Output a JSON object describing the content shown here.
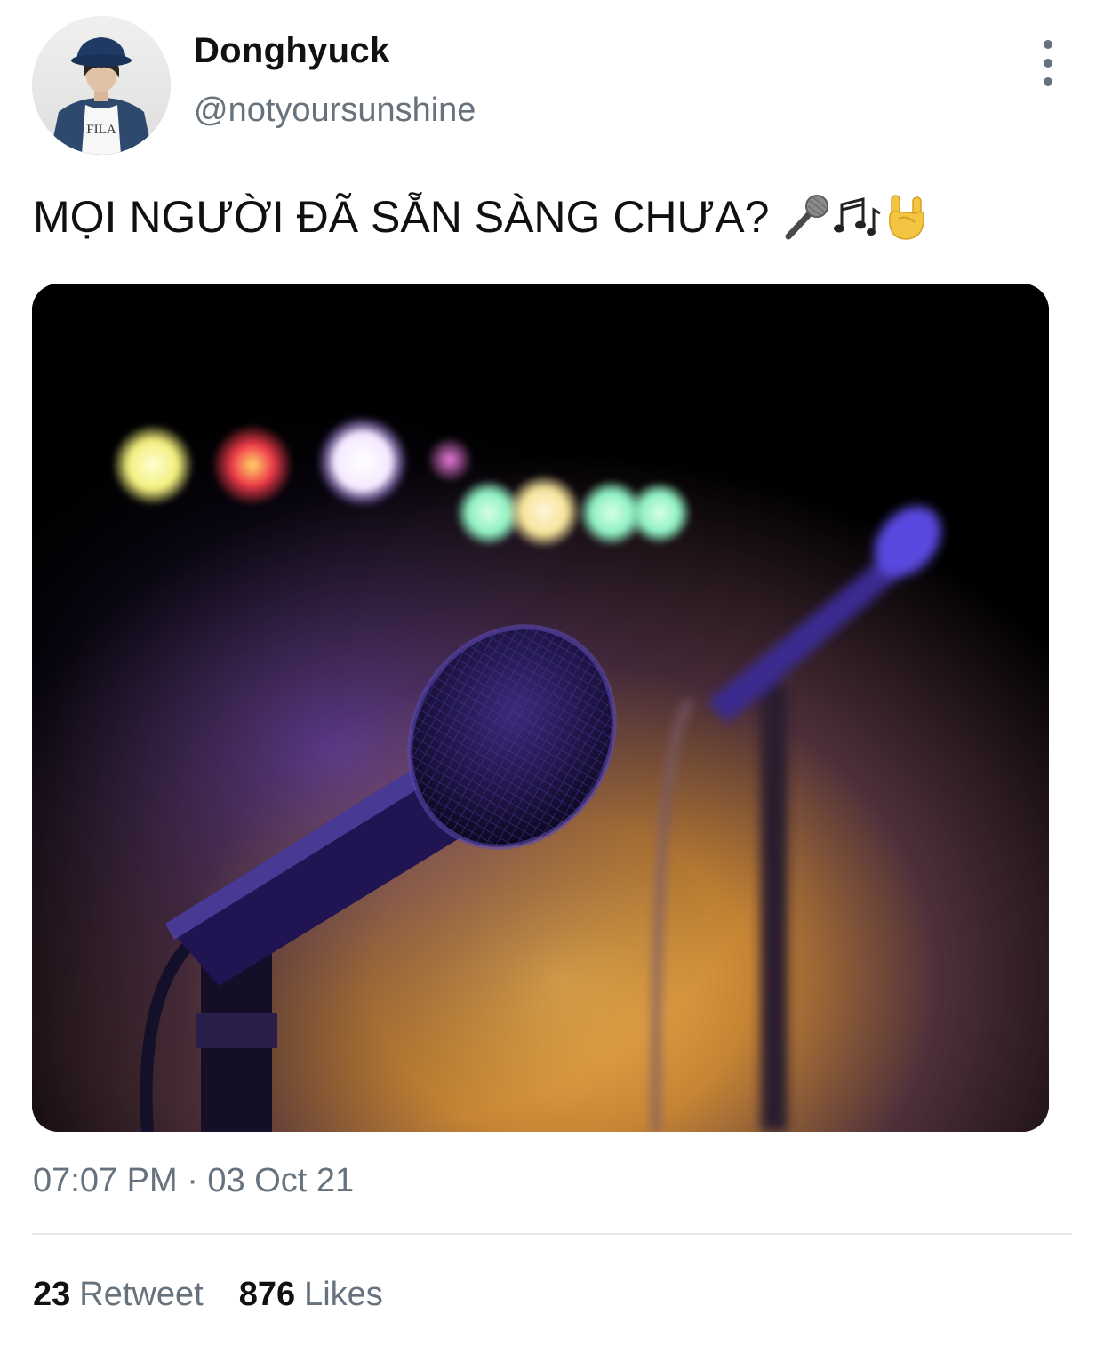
{
  "user": {
    "display_name": "Donghyuck",
    "handle": "@notyoursunshine",
    "avatar_shirt_text": "FILA"
  },
  "tweet": {
    "text": "MỌI NGƯỜI ĐÃ SẴN SÀNG CHƯA?",
    "emojis": [
      "microphone-icon",
      "music-notes-icon",
      "rock-hand-icon"
    ],
    "timestamp": "07:07 PM · 03 Oct 21"
  },
  "stats": {
    "retweets_count": "23",
    "retweets_label": "Retweet",
    "likes_count": "876",
    "likes_label": "Likes"
  },
  "colors": {
    "secondary_text": "#66727d",
    "divider": "#e6e9ec",
    "primary_text": "#0f1419"
  }
}
